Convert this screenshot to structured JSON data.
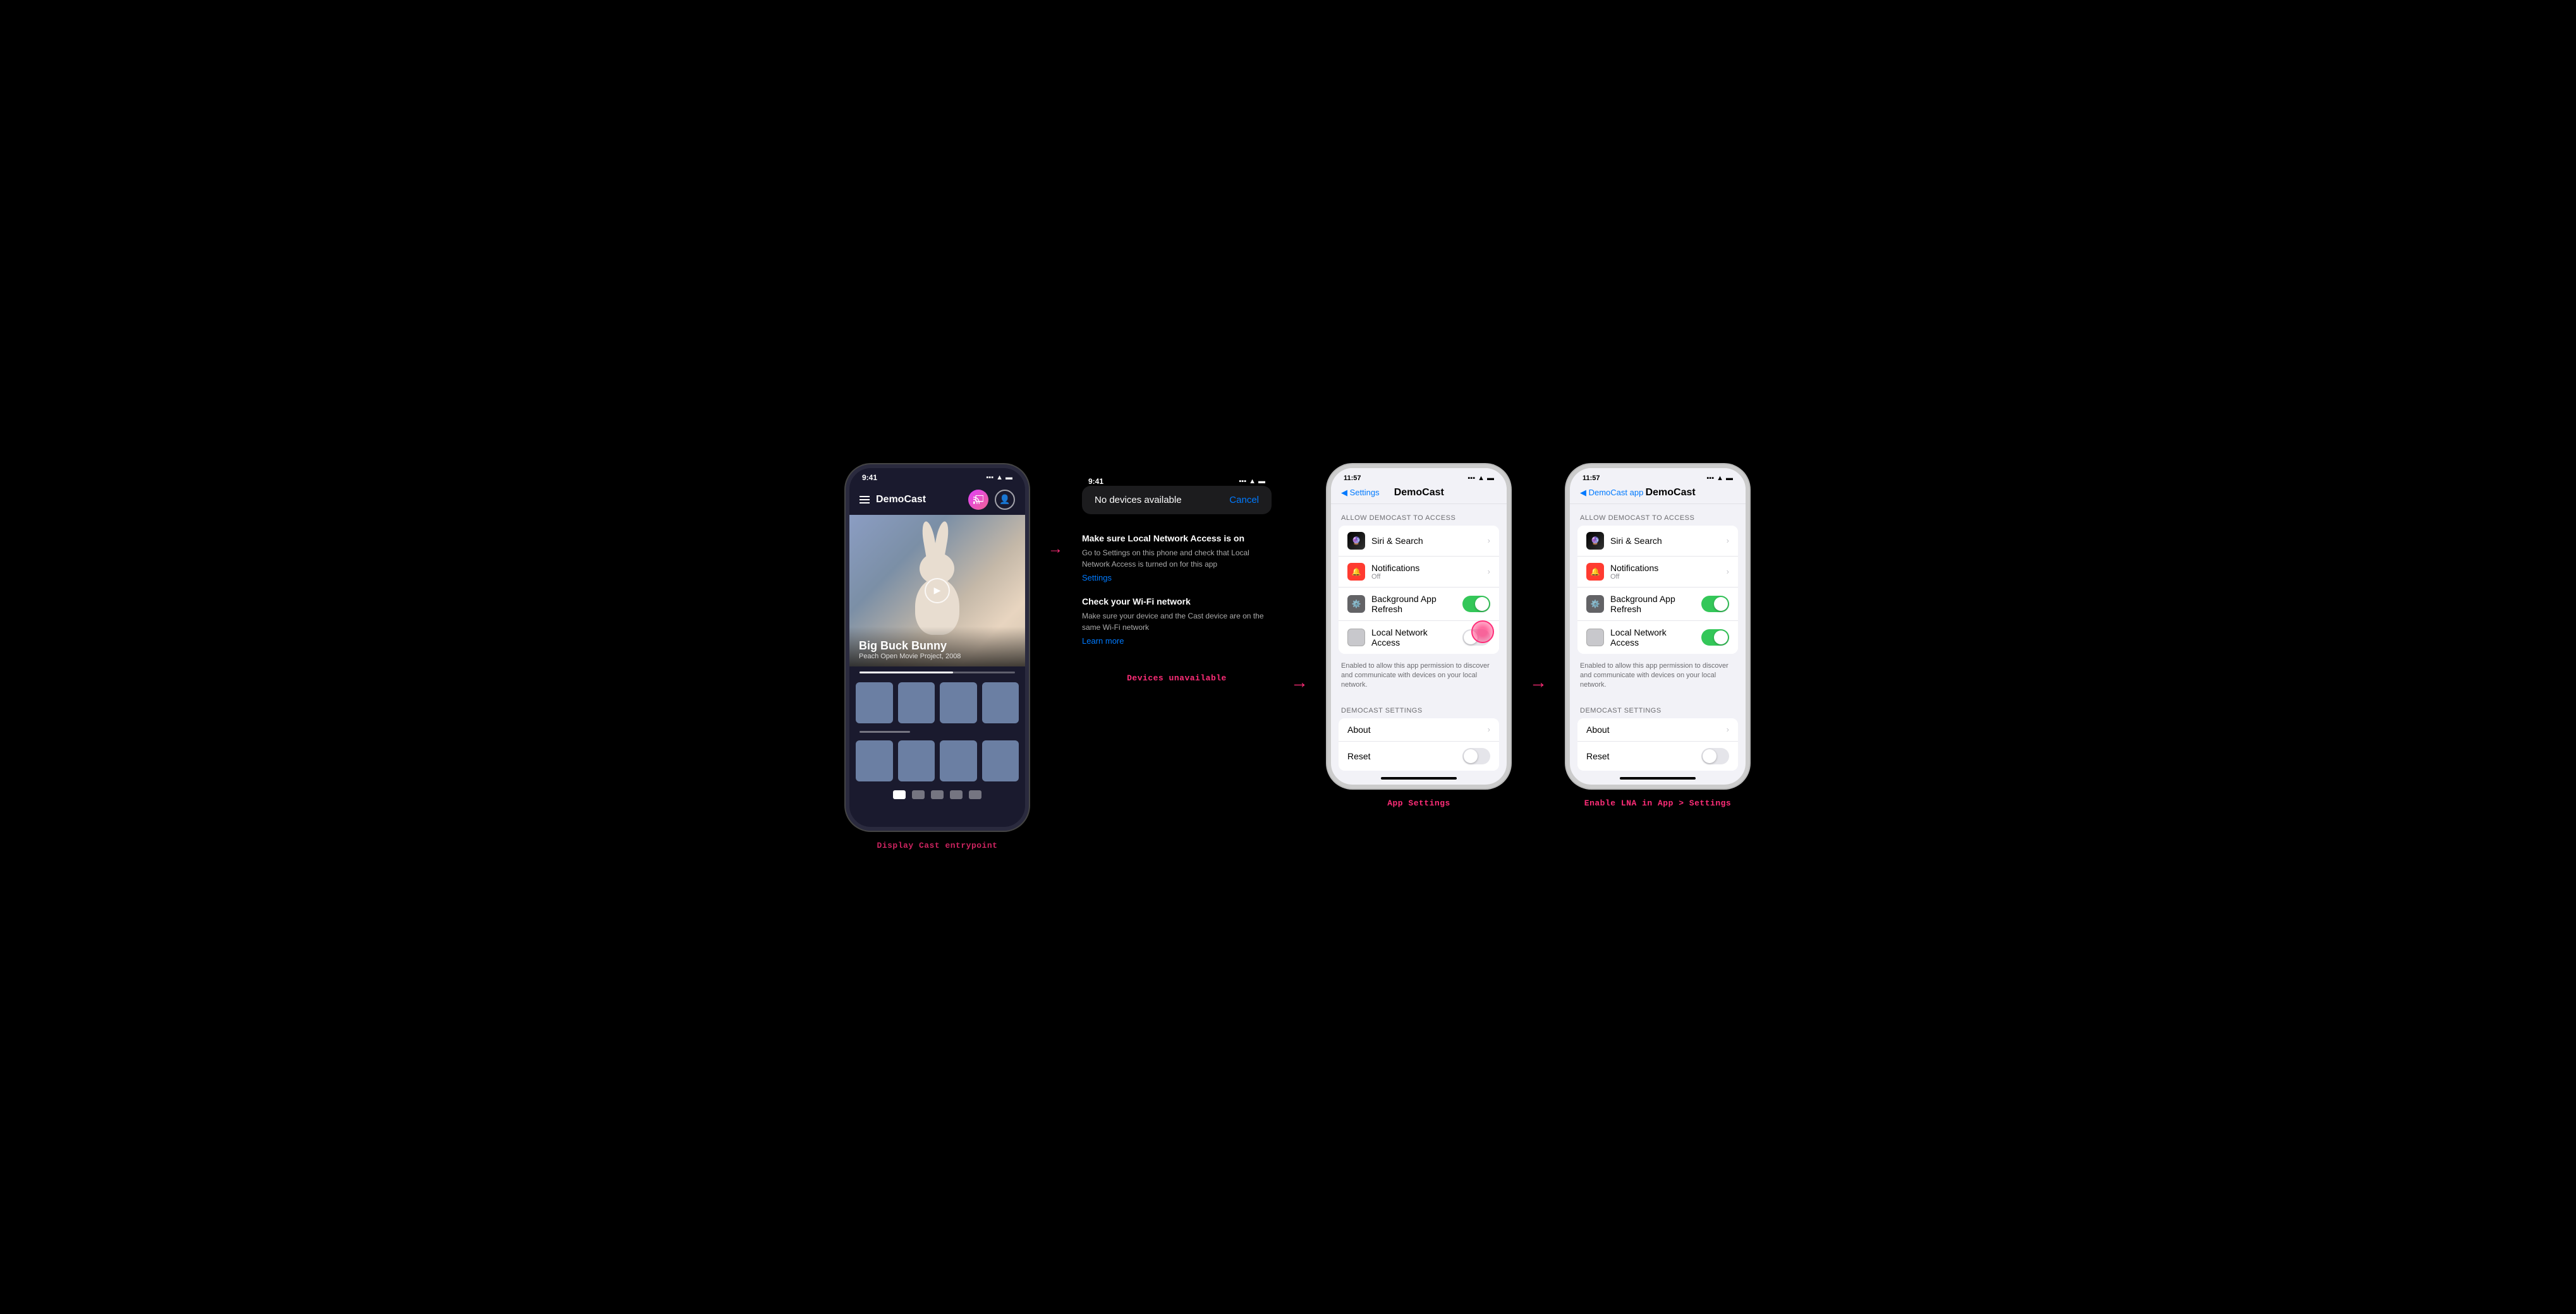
{
  "panels": {
    "panel1": {
      "label": "Display Cast entrypoint",
      "status_time": "9:41",
      "app_name": "DemoCast",
      "hero_title": "Big Buck Bunny",
      "hero_subtitle": "Peach Open Movie Project, 2008"
    },
    "panel2": {
      "label": "Devices unavailable",
      "status_time": "9:41",
      "no_devices_text": "No devices available",
      "cancel_text": "Cancel",
      "info1_title": "Make sure Local Network Access is on",
      "info1_body": "Go to Settings on this phone and check that Local Network Access is turned on for this app",
      "info1_link": "Settings",
      "info2_title": "Check your Wi-Fi network",
      "info2_body": "Make sure your device and the Cast device are on the same Wi-Fi network",
      "info2_link": "Learn more"
    },
    "panel3": {
      "label": "App Settings",
      "status_time": "11:57",
      "back_label": "◀ Settings",
      "page_title": "DemoCast",
      "section1_header": "ALLOW DEMOCAST TO ACCESS",
      "siri_label": "Siri & Search",
      "notif_label": "Notifications",
      "notif_sub": "Off",
      "bg_refresh_label": "Background App Refresh",
      "lna_label": "Local Network Access",
      "lna_desc": "Enabled to allow this app permission to discover and communicate with devices on your local network.",
      "section2_header": "DEMOCAST SETTINGS",
      "about_label": "About",
      "reset_label": "Reset"
    },
    "panel4": {
      "label": "Enable LNA in App > Settings",
      "status_time": "11:57",
      "back_label": "◀ DemoCast app",
      "page_title": "DemoCast",
      "section1_header": "ALLOW DEMOCAST TO ACCESS",
      "siri_label": "Siri & Search",
      "notif_label": "Notifications",
      "notif_sub": "Off",
      "bg_refresh_label": "Background App Refresh",
      "lna_label": "Local Network Access",
      "lna_desc": "Enabled to allow this app permission to discover and communicate with devices on your local network.",
      "section2_header": "DEMOCAST SETTINGS",
      "about_label": "About",
      "reset_label": "Reset"
    }
  }
}
